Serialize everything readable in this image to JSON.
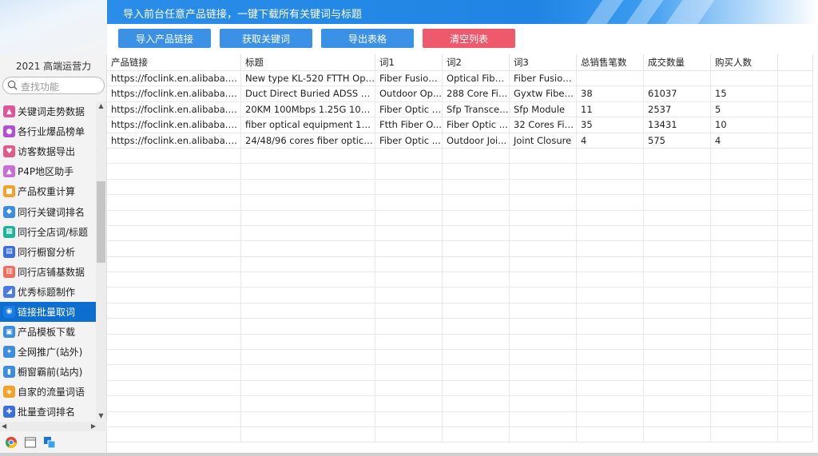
{
  "banner": {
    "title": "导入前台任意产品链接，一键下载所有关键词与标题"
  },
  "toolbar": {
    "import": "导入产品链接",
    "fetch": "获取关键词",
    "export": "导出表格",
    "clear": "清空列表"
  },
  "sidebar": {
    "brand": "2021 高端运营力",
    "search_placeholder": "查找功能",
    "items": [
      {
        "label": "关键词走势数据",
        "icon": "chart-icon",
        "color": "#e0559a"
      },
      {
        "label": "各行业爆品榜单",
        "icon": "fire-icon",
        "color": "#b44cd6"
      },
      {
        "label": "访客数据导出",
        "icon": "user-icon",
        "color": "#e05a8a"
      },
      {
        "label": "P4P地区助手",
        "icon": "map-icon",
        "color": "#c86dd7"
      },
      {
        "label": "产品权重计算",
        "icon": "calc-icon",
        "color": "#f2a12a"
      },
      {
        "label": "同行关键词排名",
        "icon": "rank-icon",
        "color": "#3b8de0"
      },
      {
        "label": "同行全店词/标题",
        "icon": "store-icon",
        "color": "#1fb39a"
      },
      {
        "label": "同行橱窗分析",
        "icon": "window-icon",
        "color": "#3b6fe0"
      },
      {
        "label": "同行店铺基数据",
        "icon": "shop-icon",
        "color": "#f26d5b"
      },
      {
        "label": "优秀标题制作",
        "icon": "title-icon",
        "color": "#4b7be0"
      },
      {
        "label": "链接批量取词",
        "icon": "link-icon",
        "color": "#1a7be0"
      },
      {
        "label": "产品模板下载",
        "icon": "download-icon",
        "color": "#3b8de0"
      },
      {
        "label": "全网推广(站外)",
        "icon": "globe-icon",
        "color": "#3b8de0"
      },
      {
        "label": "橱窗霸前(站内)",
        "icon": "bar-icon",
        "color": "#3b8de0"
      },
      {
        "label": "自家的流量词语",
        "icon": "tag-icon",
        "color": "#f2a12a"
      },
      {
        "label": "批量查词排名",
        "icon": "search-icon",
        "color": "#3b6fe0"
      }
    ],
    "active_index": 10
  },
  "table": {
    "columns": [
      "产品链接",
      "标题",
      "词1",
      "词2",
      "词3",
      "总销售笔数",
      "成交数量",
      "购买人数"
    ],
    "rows": [
      [
        "https://foclink.en.alibaba.com...",
        "New type KL-520 FTTH Opti...",
        "Fiber Fusion ...",
        "Optical Fiber...",
        "Fiber Fusion ...",
        "",
        "",
        ""
      ],
      [
        "https://foclink.en.alibaba.com...",
        "Duct Direct Buried ADSS GY...",
        "Outdoor Op...",
        "288 Core Fib...",
        "Gyxtw Fiber ...",
        "38",
        "61037",
        "15"
      ],
      [
        "https://foclink.en.alibaba.com...",
        "20KM 100Mbps 1.25G 10G ...",
        "Fiber Optic T...",
        "Sfp Transcei...",
        "Sfp Module",
        "11",
        "2537",
        "5"
      ],
      [
        "https://foclink.en.alibaba.com...",
        "fiber optical equipment 16 3...",
        "Ftth Fiber O...",
        "Fiber Optic ...",
        "32 Cores Fib...",
        "35",
        "13431",
        "10"
      ],
      [
        "https://foclink.en.alibaba.com...",
        "24/48/96 cores fiber optic d...",
        "Fiber Optic ...",
        "Outdoor Joi...",
        "Joint Closure",
        "4",
        "575",
        "4"
      ]
    ]
  }
}
